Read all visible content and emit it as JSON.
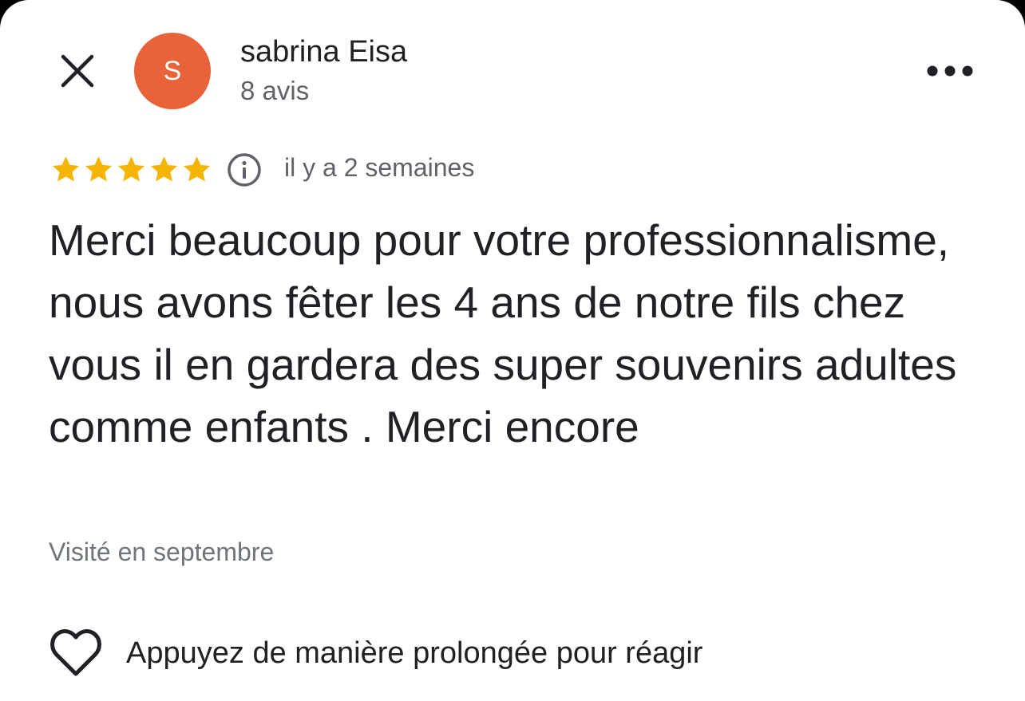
{
  "header": {
    "close_icon": "close-icon",
    "author_name": "sabrina Eisa",
    "author_initial": "S",
    "avatar_color": "#e8623a",
    "review_count": "8 avis",
    "more_icon": "more-horizontal-icon"
  },
  "review": {
    "rating": 5,
    "max_rating": 5,
    "star_color": "#f4b400",
    "info_icon": "info-icon",
    "time_ago": "il y a 2 semaines",
    "text": "Merci beaucoup pour votre professionnalisme, nous avons fêter les 4 ans de notre fils chez vous il en gardera des super souvenirs adultes comme enfants . Merci encore",
    "visited": "Visité en septembre"
  },
  "reaction": {
    "icon": "heart-icon",
    "label": "Appuyez de manière prolongée pour réagir"
  }
}
